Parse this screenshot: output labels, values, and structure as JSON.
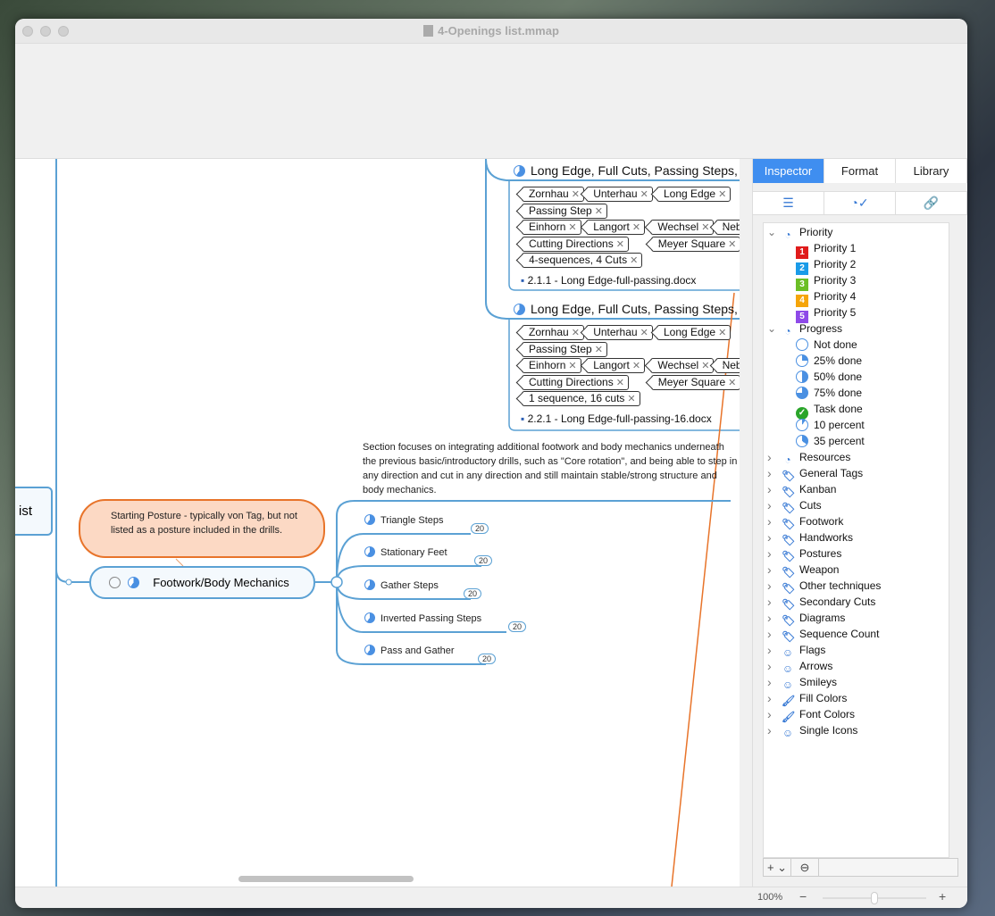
{
  "window": {
    "title": "4-Openings list.mmap"
  },
  "map": {
    "root_partial": "ist",
    "blocks": [
      {
        "header": "Long Edge, Full Cuts, Passing Steps,",
        "tag_rows": [
          [
            "Zornhau",
            "Unterhau",
            "Long Edge"
          ],
          [
            "Passing Step"
          ],
          [
            "Einhorn",
            "Langort",
            "Wechsel",
            "Neb"
          ],
          [
            "Cutting Directions",
            "Meyer Square"
          ],
          [
            "4-sequences, 4 Cuts"
          ]
        ],
        "file": "2.1.1 - Long Edge-full-passing.docx"
      },
      {
        "header": "Long Edge, Full Cuts, Passing Steps,",
        "tag_rows": [
          [
            "Zornhau",
            "Unterhau",
            "Long Edge"
          ],
          [
            "Passing Step"
          ],
          [
            "Einhorn",
            "Langort",
            "Wechsel",
            "Neb"
          ],
          [
            "Cutting Directions",
            "Meyer Square"
          ],
          [
            "1 sequence, 16 cuts"
          ]
        ],
        "file": "2.2.1 - Long Edge-full-passing-16.docx"
      }
    ],
    "note": "Section focuses on integrating additional footwork and body mechanics underneath the previous basic/introductory drills, such as \"Core rotation\", and being able to step in any direction and cut in any direction and still maintain stable/strong structure and body mechanics.",
    "callout": "Starting Posture - typically von Tag, but not listed as a posture included in the drills.",
    "topic": "Footwork/Body Mechanics",
    "children": [
      {
        "label": "Triangle Steps",
        "count": "20"
      },
      {
        "label": "Stationary Feet",
        "count": "20"
      },
      {
        "label": "Gather Steps",
        "count": "20"
      },
      {
        "label": "Inverted Passing Steps",
        "count": "20"
      },
      {
        "label": "Pass and Gather",
        "count": "20"
      }
    ]
  },
  "sidebar": {
    "tabs": [
      "Inspector",
      "Format",
      "Library"
    ],
    "active_tab": "Inspector",
    "tree": [
      {
        "label": "Priority",
        "expanded": true,
        "icon": "clock-check-icon",
        "items": [
          {
            "label": "Priority 1",
            "glyph": "1",
            "color": "#e01b1b"
          },
          {
            "label": "Priority 2",
            "glyph": "2",
            "color": "#1a9be8"
          },
          {
            "label": "Priority 3",
            "glyph": "3",
            "color": "#6cbf26"
          },
          {
            "label": "Priority 4",
            "glyph": "4",
            "color": "#f5a50a"
          },
          {
            "label": "Priority 5",
            "glyph": "5",
            "color": "#8e4ae8"
          }
        ]
      },
      {
        "label": "Progress",
        "expanded": true,
        "icon": "clock-check-icon",
        "items": [
          {
            "label": "Not done",
            "pct": 0
          },
          {
            "label": "25% done",
            "pct": 25
          },
          {
            "label": "50% done",
            "pct": 50
          },
          {
            "label": "75% done",
            "pct": 75
          },
          {
            "label": "Task done",
            "pct": 100
          },
          {
            "label": "10 percent",
            "pct": 10
          },
          {
            "label": "35 percent",
            "pct": 35
          }
        ]
      },
      {
        "label": "Resources",
        "icon": "clock-check-icon"
      },
      {
        "label": "General Tags",
        "icon": "tag-icon"
      },
      {
        "label": "Kanban",
        "icon": "tag-icon"
      },
      {
        "label": "Cuts",
        "icon": "tag-icon"
      },
      {
        "label": "Footwork",
        "icon": "tag-icon"
      },
      {
        "label": "Handworks",
        "icon": "tag-icon"
      },
      {
        "label": "Postures",
        "icon": "tag-icon"
      },
      {
        "label": "Weapon",
        "icon": "tag-icon"
      },
      {
        "label": "Other techniques",
        "icon": "tag-icon"
      },
      {
        "label": "Secondary Cuts",
        "icon": "tag-icon"
      },
      {
        "label": "Diagrams",
        "icon": "tag-icon"
      },
      {
        "label": "Sequence Count",
        "icon": "tag-icon"
      },
      {
        "label": "Flags",
        "icon": "smiley-icon"
      },
      {
        "label": "Arrows",
        "icon": "smiley-icon"
      },
      {
        "label": "Smileys",
        "icon": "smiley-icon"
      },
      {
        "label": "Fill Colors",
        "icon": "brush-icon"
      },
      {
        "label": "Font Colors",
        "icon": "brush-icon"
      },
      {
        "label": "Single Icons",
        "icon": "smiley-icon"
      }
    ]
  },
  "status": {
    "zoom": "100%",
    "zoom_slider": 0.5
  },
  "colors": {
    "accent": "#3f8ef0",
    "branch": "#5ba1d4",
    "callout_fill": "#fcd9c4",
    "callout_border": "#e8742a"
  }
}
